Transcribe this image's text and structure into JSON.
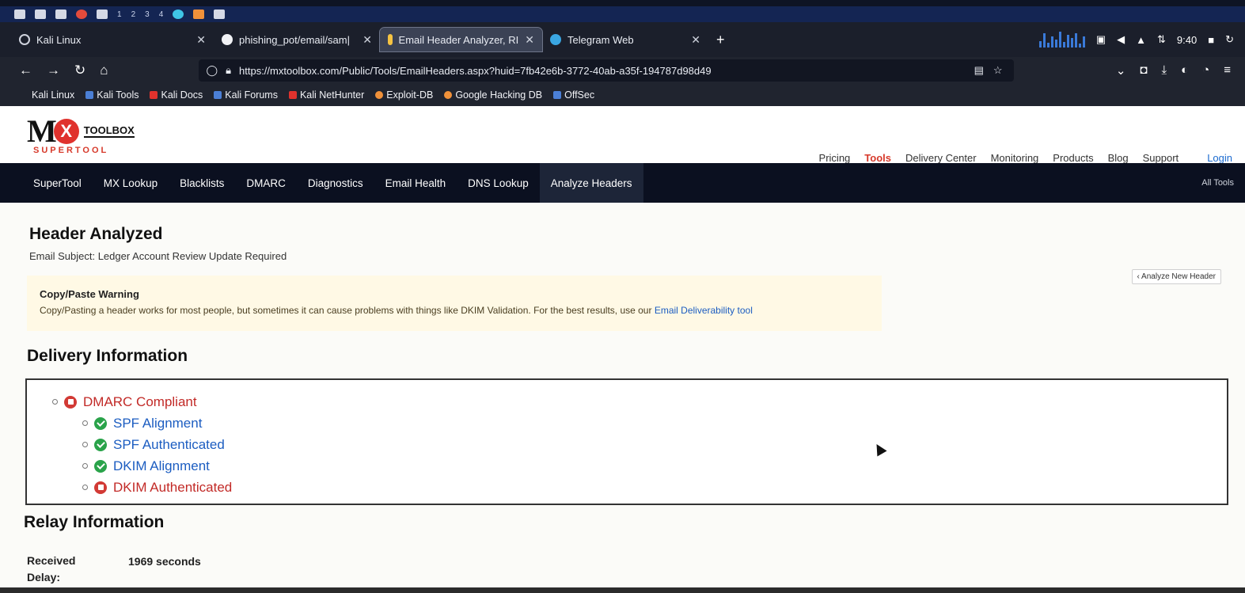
{
  "panel": {
    "workspaces": [
      "1",
      "2",
      "3",
      "4"
    ],
    "time": "9:40"
  },
  "tabs": [
    {
      "title": "Kali Linux",
      "active": false
    },
    {
      "title": "phishing_pot/email/sam|",
      "active": false
    },
    {
      "title": "Email Header Analyzer, RI",
      "active": true
    },
    {
      "title": "Telegram Web",
      "active": false
    }
  ],
  "nav": {
    "url": "https://mxtoolbox.com/Public/Tools/EmailHeaders.aspx?huid=7fb42e6b-3772-40ab-a35f-194787d98d49"
  },
  "bookmarks": [
    {
      "label": "Kali Linux",
      "color": "#4b7fd6"
    },
    {
      "label": "Kali Tools",
      "color": "#4b7fd6"
    },
    {
      "label": "Kali Docs",
      "color": "#e0322d"
    },
    {
      "label": "Kali Forums",
      "color": "#4b7fd6"
    },
    {
      "label": "Kali NetHunter",
      "color": "#e0322d"
    },
    {
      "label": "Exploit-DB",
      "color": "#f0913a"
    },
    {
      "label": "Google Hacking DB",
      "color": "#f0913a"
    },
    {
      "label": "OffSec",
      "color": "#4b7fd6"
    }
  ],
  "site": {
    "logo_text": "TOOLBOX",
    "logo_sub": "SUPERTOOL",
    "topnav": [
      "Pricing",
      "Tools",
      "Delivery Center",
      "Monitoring",
      "Products",
      "Blog",
      "Support"
    ],
    "login": "Login"
  },
  "toolnav": {
    "items": [
      "SuperTool",
      "MX Lookup",
      "Blacklists",
      "DMARC",
      "Diagnostics",
      "Email Health",
      "DNS Lookup",
      "Analyze Headers"
    ],
    "all_tools": "All Tools"
  },
  "page": {
    "title": "Header Analyzed",
    "subject": "Email Subject: Ledger Account Review Update Required",
    "analyze_new": "‹ Analyze New Header",
    "warning_title": "Copy/Paste Warning",
    "warning_body": "Copy/Pasting a header works for most people, but sometimes it can cause problems with things like DKIM Validation. For the best results, use our ",
    "warning_link": "Email Deliverability tool",
    "delivery_title": "Delivery Information",
    "relay_title": "Relay Information",
    "received_delay_label": "Received Delay:",
    "received_delay_value": "1969 seconds"
  },
  "checks": {
    "dmarc": {
      "label": "DMARC Compliant",
      "status": "fail"
    },
    "spf_alignment": {
      "label": "SPF Alignment",
      "status": "pass"
    },
    "spf_authenticated": {
      "label": "SPF Authenticated",
      "status": "pass"
    },
    "dkim_alignment": {
      "label": "DKIM Alignment",
      "status": "pass"
    },
    "dkim_authenticated": {
      "label": "DKIM Authenticated",
      "status": "fail"
    }
  },
  "colors": {
    "brand_red": "#d73a2b",
    "pass": "#2aa34a",
    "fail": "#d23a35",
    "link": "#1c5dc1"
  }
}
